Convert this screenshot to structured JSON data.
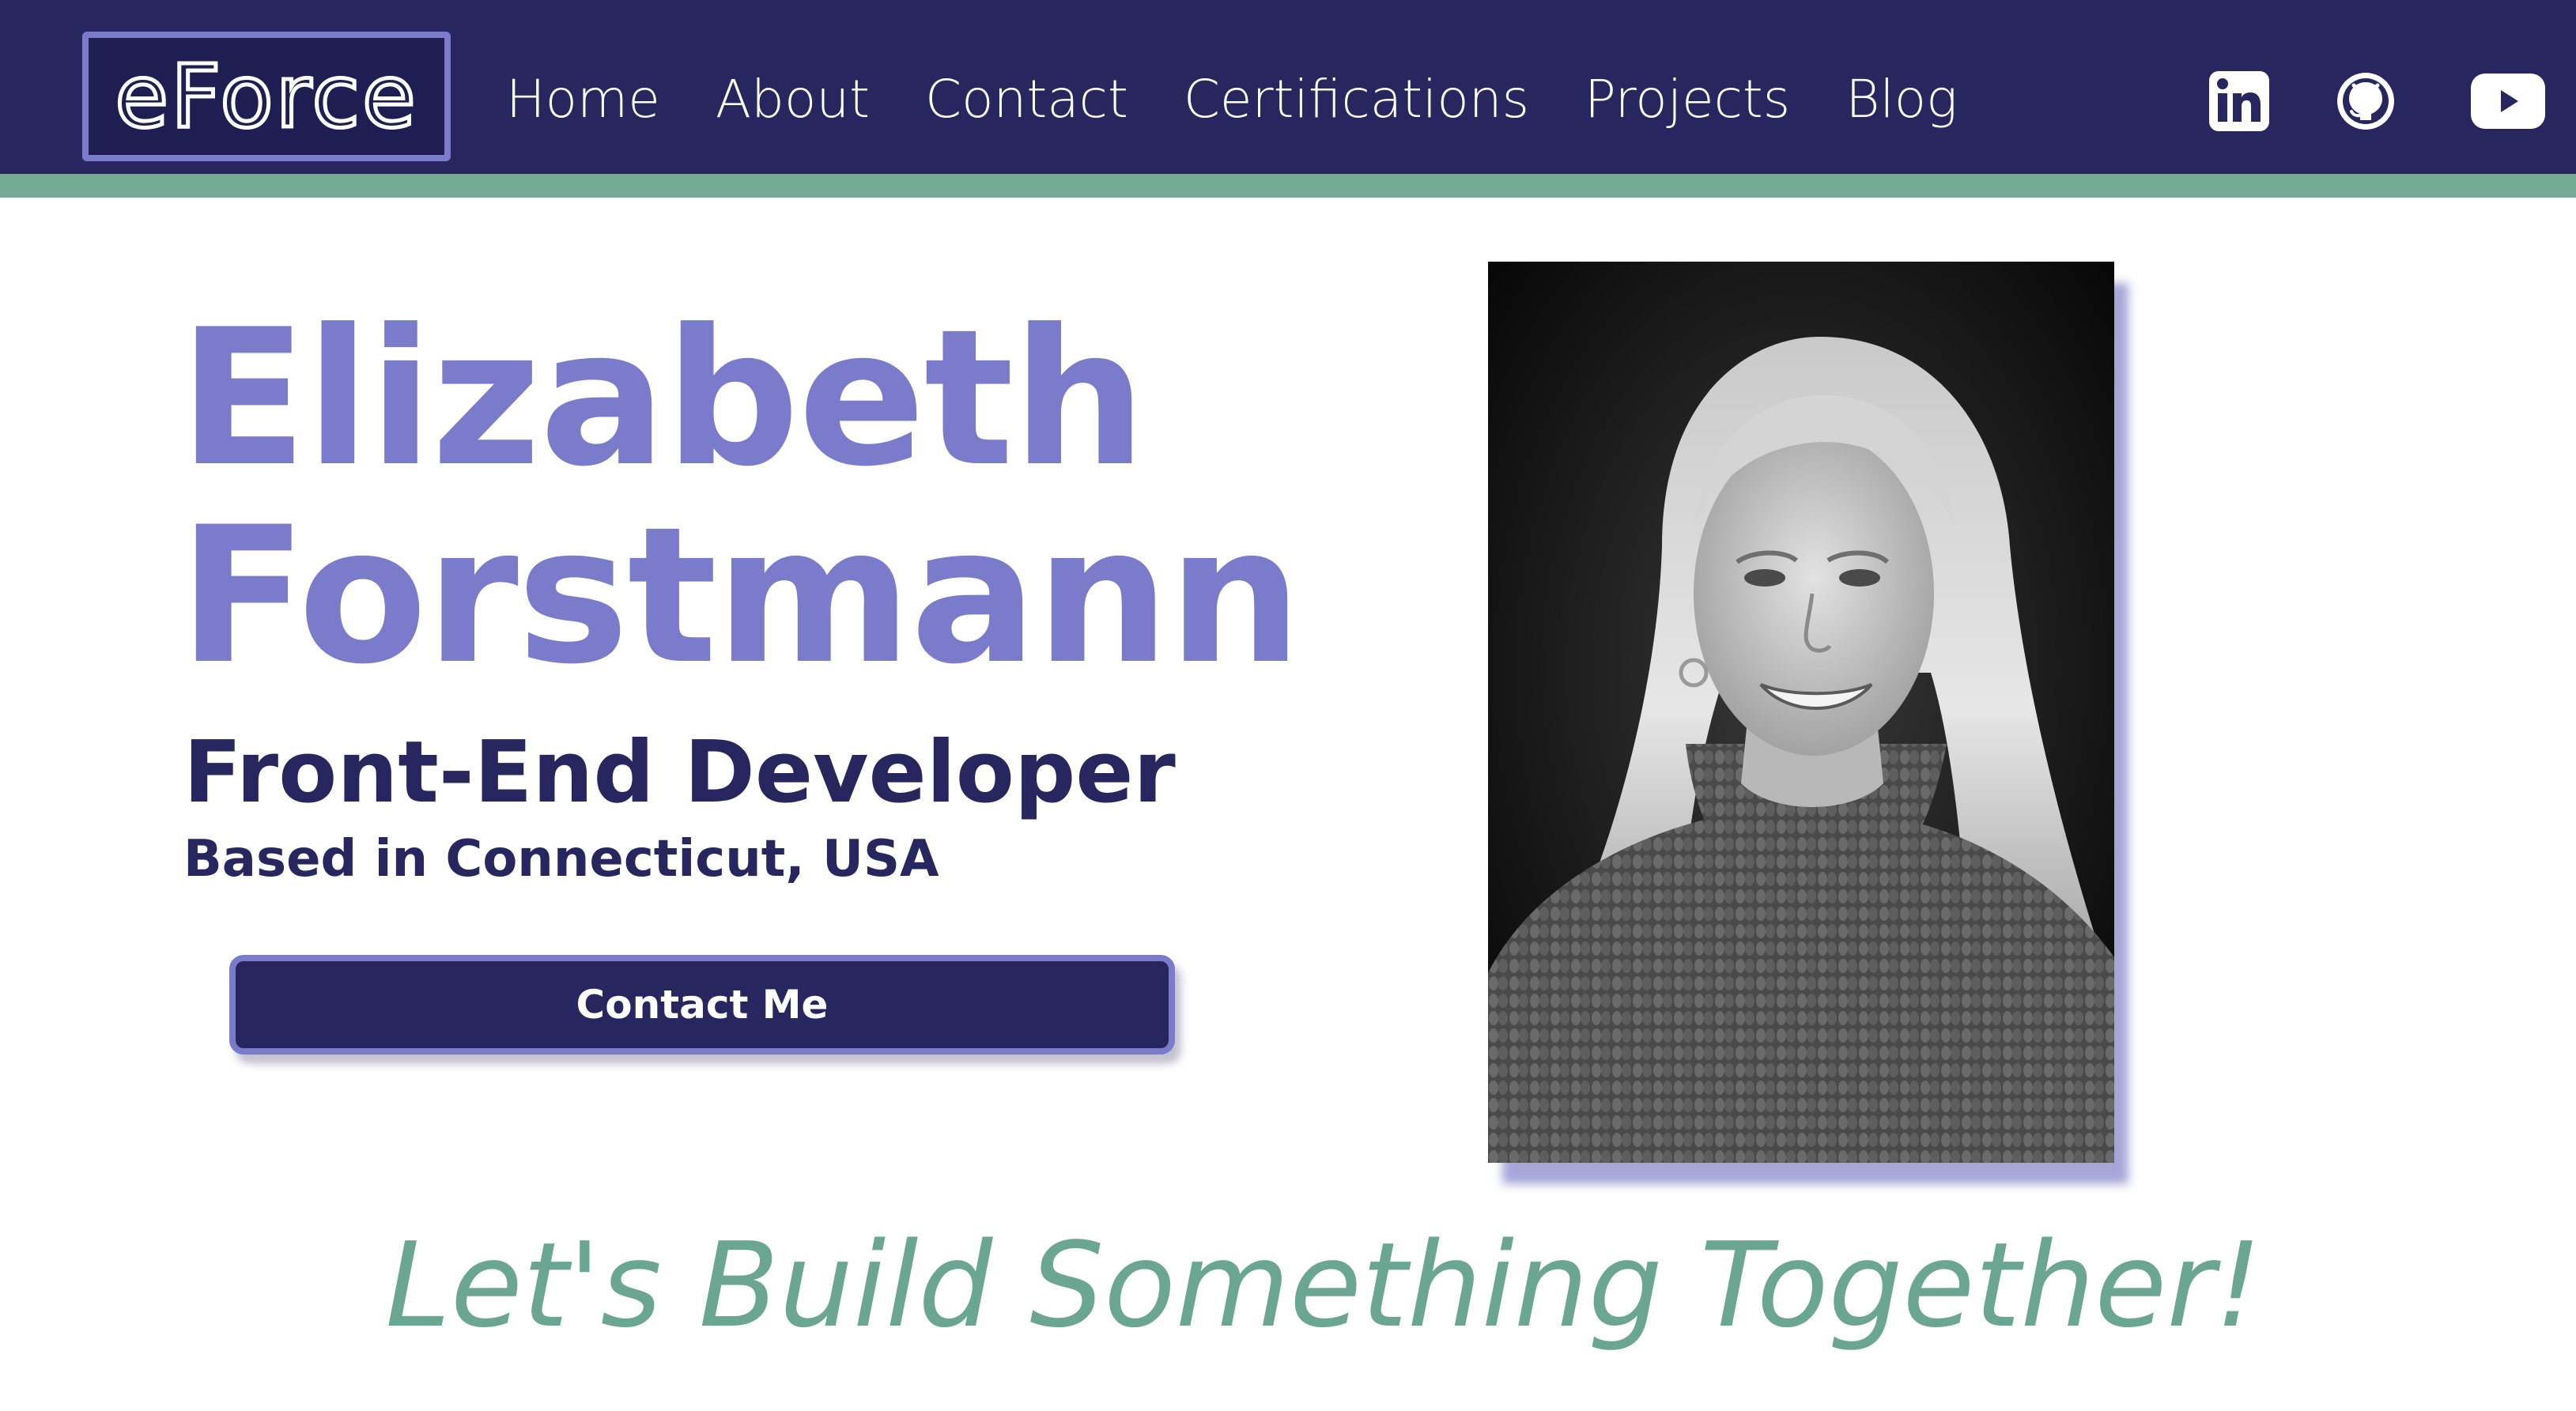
{
  "brand": {
    "logo_text": "eForce"
  },
  "nav": {
    "links": [
      {
        "label": "Home"
      },
      {
        "label": "About"
      },
      {
        "label": "Contact"
      },
      {
        "label": "Certifications"
      },
      {
        "label": "Projects"
      },
      {
        "label": "Blog"
      }
    ],
    "social_icons": [
      "linkedin-icon",
      "github-icon",
      "youtube-icon"
    ]
  },
  "hero": {
    "first_name": "Elizabeth",
    "last_name": "Forstmann",
    "role": "Front-End Developer",
    "location": "Based in Connecticut, USA",
    "cta_label": "Contact Me"
  },
  "tagline": "Let's Build Something Together!",
  "colors": {
    "navbar_bg": "#27265e",
    "accent_stripe": "#74ab96",
    "name_purple": "#7a7bcb",
    "logo_border": "#7b7bcc",
    "tagline_green": "#6aa692",
    "text_dark": "#27265e"
  }
}
